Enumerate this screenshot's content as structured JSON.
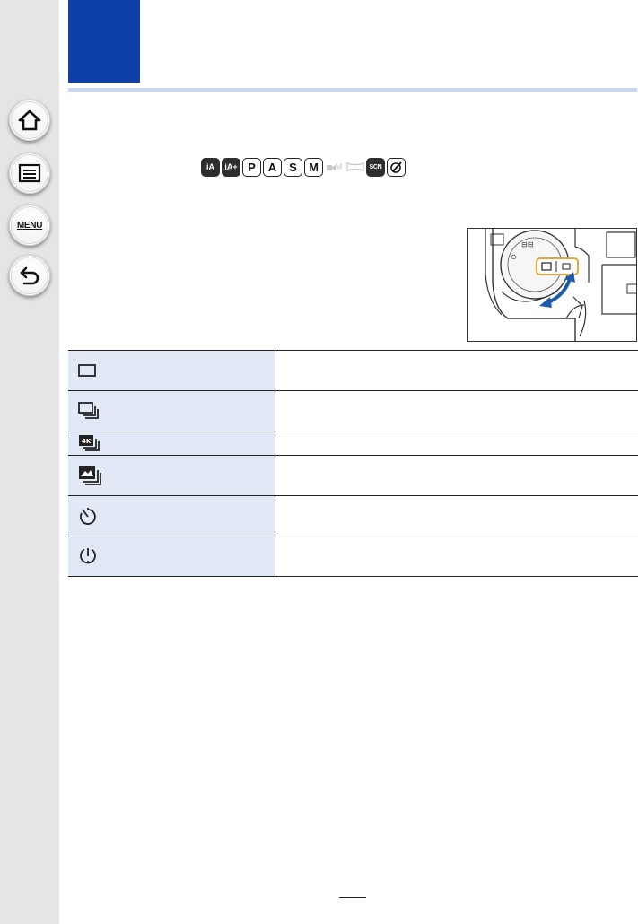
{
  "sidebar": {
    "buttons": [
      {
        "name": "home-button",
        "icon": "home-icon"
      },
      {
        "name": "contents-button",
        "icon": "list-icon"
      },
      {
        "name": "menu-button",
        "icon": "menu-icon",
        "label": "MENU"
      },
      {
        "name": "back-button",
        "icon": "return-icon"
      }
    ]
  },
  "header": {
    "accent_color": "#0d3fa7",
    "rule_color": "#c9d8f0"
  },
  "mode_icons": {
    "letters": {
      "p": "P",
      "a": "A",
      "s": "S",
      "m": "M",
      "scn": "SCN",
      "movie_m": "M"
    }
  },
  "drive_table": {
    "label_background": "#e1e9f7",
    "rows": [
      {
        "icon": "single-icon"
      },
      {
        "icon": "burst-icon"
      },
      {
        "icon": "4k-photo-icon"
      },
      {
        "icon": "post-focus-icon"
      },
      {
        "icon": "self-timer-icon"
      },
      {
        "icon": "interval-timer-icon"
      }
    ]
  }
}
